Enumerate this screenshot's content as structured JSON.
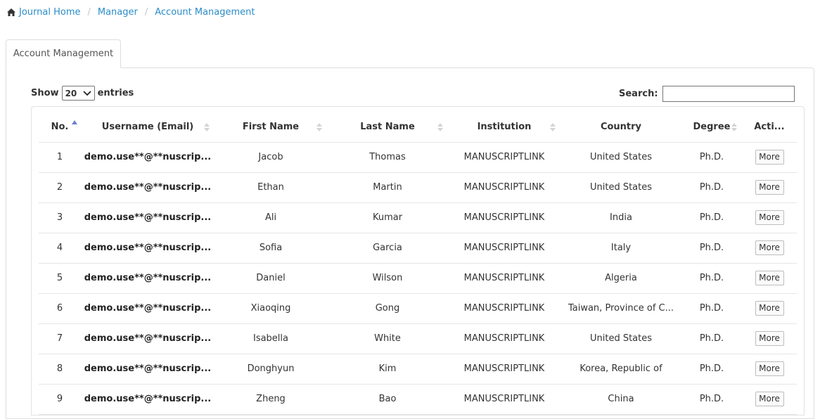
{
  "breadcrumb": {
    "items": [
      {
        "label": "Journal Home"
      },
      {
        "label": "Manager"
      },
      {
        "label": "Account Management"
      }
    ],
    "separator": "/"
  },
  "tab": {
    "label": "Account Management"
  },
  "length_control": {
    "prefix": "Show",
    "value": "20",
    "suffix": "entries"
  },
  "search": {
    "label": "Search:",
    "value": "",
    "placeholder": ""
  },
  "table": {
    "columns": [
      "No.",
      "Username (Email)",
      "First Name",
      "Last Name",
      "Institution",
      "Country",
      "Degree",
      "Acti..."
    ],
    "rows": [
      {
        "no": "1",
        "user": "demo.use**@**nuscrip...",
        "first": "Jacob",
        "last": "Thomas",
        "inst": "MANUSCRIPTLINK",
        "country": "United States",
        "degree": "Ph.D.",
        "action": "More"
      },
      {
        "no": "2",
        "user": "demo.use**@**nuscrip...",
        "first": "Ethan",
        "last": "Martin",
        "inst": "MANUSCRIPTLINK",
        "country": "United States",
        "degree": "Ph.D.",
        "action": "More"
      },
      {
        "no": "3",
        "user": "demo.use**@**nuscrip...",
        "first": "Ali",
        "last": "Kumar",
        "inst": "MANUSCRIPTLINK",
        "country": "India",
        "degree": "Ph.D.",
        "action": "More"
      },
      {
        "no": "4",
        "user": "demo.use**@**nuscrip...",
        "first": "Sofia",
        "last": "Garcia",
        "inst": "MANUSCRIPTLINK",
        "country": "Italy",
        "degree": "Ph.D.",
        "action": "More"
      },
      {
        "no": "5",
        "user": "demo.use**@**nuscrip...",
        "first": "Daniel",
        "last": "Wilson",
        "inst": "MANUSCRIPTLINK",
        "country": "Algeria",
        "degree": "Ph.D.",
        "action": "More"
      },
      {
        "no": "6",
        "user": "demo.use**@**nuscrip...",
        "first": "Xiaoqing",
        "last": "Gong",
        "inst": "MANUSCRIPTLINK",
        "country": "Taiwan, Province of C...",
        "degree": "Ph.D.",
        "action": "More"
      },
      {
        "no": "7",
        "user": "demo.use**@**nuscrip...",
        "first": "Isabella",
        "last": "White",
        "inst": "MANUSCRIPTLINK",
        "country": "United States",
        "degree": "Ph.D.",
        "action": "More"
      },
      {
        "no": "8",
        "user": "demo.use**@**nuscrip...",
        "first": "Donghyun",
        "last": "Kim",
        "inst": "MANUSCRIPTLINK",
        "country": "Korea, Republic of",
        "degree": "Ph.D.",
        "action": "More"
      },
      {
        "no": "9",
        "user": "demo.use**@**nuscrip...",
        "first": "Zheng",
        "last": "Bao",
        "inst": "MANUSCRIPTLINK",
        "country": "China",
        "degree": "Ph.D.",
        "action": "More"
      }
    ]
  },
  "colors": {
    "link": "#2a8cc8",
    "sort_active": "#6a7fd6",
    "sort_inactive": "#d4d4d4"
  },
  "icons": {
    "home": "home-icon",
    "sort_asc": "sort-asc-icon",
    "sort": "sort-icon",
    "dropdown": "chevron-down-icon"
  }
}
